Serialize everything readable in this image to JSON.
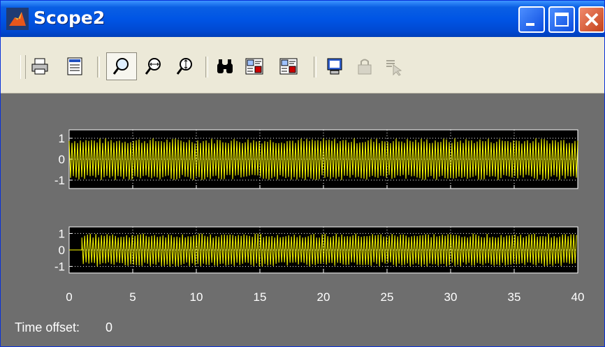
{
  "window": {
    "title": "Scope2",
    "controls": [
      "minimize",
      "maximize",
      "close"
    ]
  },
  "toolbar": {
    "buttons": [
      {
        "icon": "print-icon",
        "pressed": false,
        "enabled": true
      },
      {
        "icon": "parameters-icon",
        "pressed": false,
        "enabled": true
      },
      {
        "icon": "zoom-in-icon",
        "pressed": true,
        "enabled": true
      },
      {
        "icon": "zoom-x-icon",
        "pressed": false,
        "enabled": true
      },
      {
        "icon": "zoom-y-icon",
        "pressed": false,
        "enabled": true
      },
      {
        "icon": "autoscale-icon",
        "pressed": false,
        "enabled": true
      },
      {
        "icon": "save-axes-settings-icon",
        "pressed": false,
        "enabled": true
      },
      {
        "icon": "restore-axes-settings-icon",
        "pressed": false,
        "enabled": true
      },
      {
        "icon": "floating-scope-icon",
        "pressed": false,
        "enabled": true
      },
      {
        "icon": "lock-axes-icon",
        "pressed": false,
        "enabled": false
      },
      {
        "icon": "signal-selection-icon",
        "pressed": false,
        "enabled": false
      }
    ]
  },
  "colors": {
    "title_bar": "#0055e5",
    "toolbar_bg": "#ece9d8",
    "figure_bg": "#6e6e6e",
    "axes_bg": "#000000",
    "signal": "#ffff00",
    "grid": "#ffffff"
  },
  "status": {
    "label": "Time offset:",
    "value": "0"
  },
  "chart_data": [
    {
      "type": "line",
      "title": "",
      "xlabel": "",
      "ylabel": "",
      "xlim": [
        0,
        40
      ],
      "ylim": [
        -1.4,
        1.4
      ],
      "yticks": [
        "1",
        "0",
        "-1"
      ],
      "xtick_labels_shown": false,
      "grid": true,
      "series": [
        {
          "signal_start": 0,
          "amplitude": 1
        }
      ]
    },
    {
      "type": "line",
      "title": "",
      "xlabel": "",
      "ylabel": "",
      "xlim": [
        0,
        40
      ],
      "ylim": [
        -1.4,
        1.4
      ],
      "yticks": [
        "1",
        "0",
        "-1"
      ],
      "xticks": [
        "0",
        "5",
        "10",
        "15",
        "20",
        "25",
        "30",
        "35",
        "40"
      ],
      "grid": true,
      "series": [
        {
          "signal_start": 1,
          "amplitude": 1
        }
      ]
    }
  ]
}
